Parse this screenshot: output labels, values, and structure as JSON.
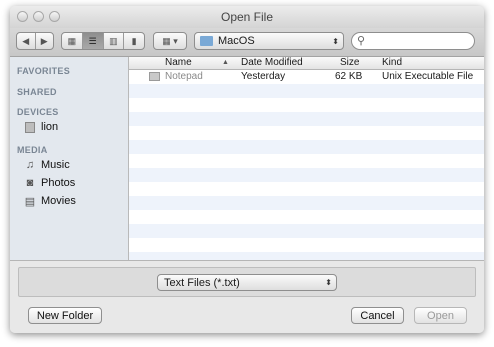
{
  "window": {
    "title": "Open File"
  },
  "toolbar": {
    "back_icon": "back-arrow-icon",
    "forward_icon": "forward-arrow-icon",
    "location": "MacOS",
    "search_placeholder": ""
  },
  "sidebar": {
    "sections": [
      {
        "heading": "FAVORITES",
        "items": []
      },
      {
        "heading": "SHARED",
        "items": []
      },
      {
        "heading": "DEVICES",
        "items": [
          {
            "label": "lion",
            "icon": "disk-icon"
          }
        ]
      },
      {
        "heading": "MEDIA",
        "items": [
          {
            "label": "Music",
            "icon": "music-note-icon"
          },
          {
            "label": "Photos",
            "icon": "camera-icon"
          },
          {
            "label": "Movies",
            "icon": "film-icon"
          }
        ]
      }
    ]
  },
  "files": {
    "columns": [
      "Name",
      "Date Modified",
      "Size",
      "Kind"
    ],
    "rows": [
      {
        "name": "Notepad",
        "date": "Yesterday",
        "size": "62 KB",
        "kind": "Unix Executable File"
      }
    ]
  },
  "filter": {
    "selected": "Text Files (*.txt)"
  },
  "buttons": {
    "new_folder": "New Folder",
    "cancel": "Cancel",
    "open": "Open"
  }
}
